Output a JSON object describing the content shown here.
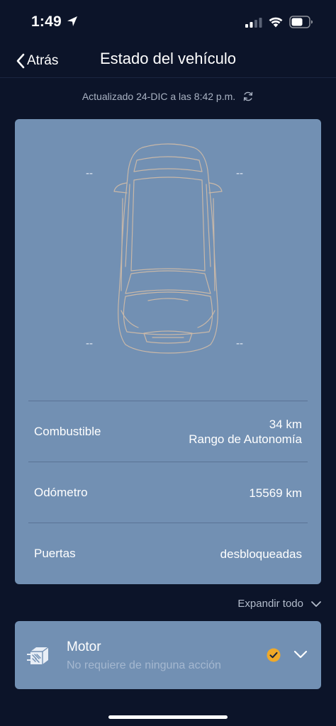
{
  "status_bar": {
    "time": "1:49",
    "icons": [
      "location-arrow-icon",
      "cellular-signal-icon",
      "wifi-icon",
      "battery-icon"
    ]
  },
  "nav": {
    "back_label": "Atrás",
    "title": "Estado del vehículo"
  },
  "updated": {
    "text": "Actualizado 24-DIC a las 8:42 p.m.",
    "icon": "refresh-icon"
  },
  "vehicle": {
    "tires": {
      "front_left": "--",
      "front_right": "--",
      "rear_left": "--",
      "rear_right": "--"
    },
    "info": [
      {
        "label": "Combustible",
        "value": "34 km",
        "subvalue": "Rango de Autonomía"
      },
      {
        "label": "Odómetro",
        "value": "15569 km"
      },
      {
        "label": "Puertas",
        "value": "desbloqueadas"
      }
    ]
  },
  "expand_all_label": "Expandir todo",
  "sections": [
    {
      "title": "Motor",
      "subtitle": "No requiere de ninguna acción",
      "icon": "engine-icon",
      "status_icon": "check-circle-icon"
    }
  ],
  "colors": {
    "background": "#0c1429",
    "card": "#7290b3",
    "status_ok": "#f0a928"
  }
}
